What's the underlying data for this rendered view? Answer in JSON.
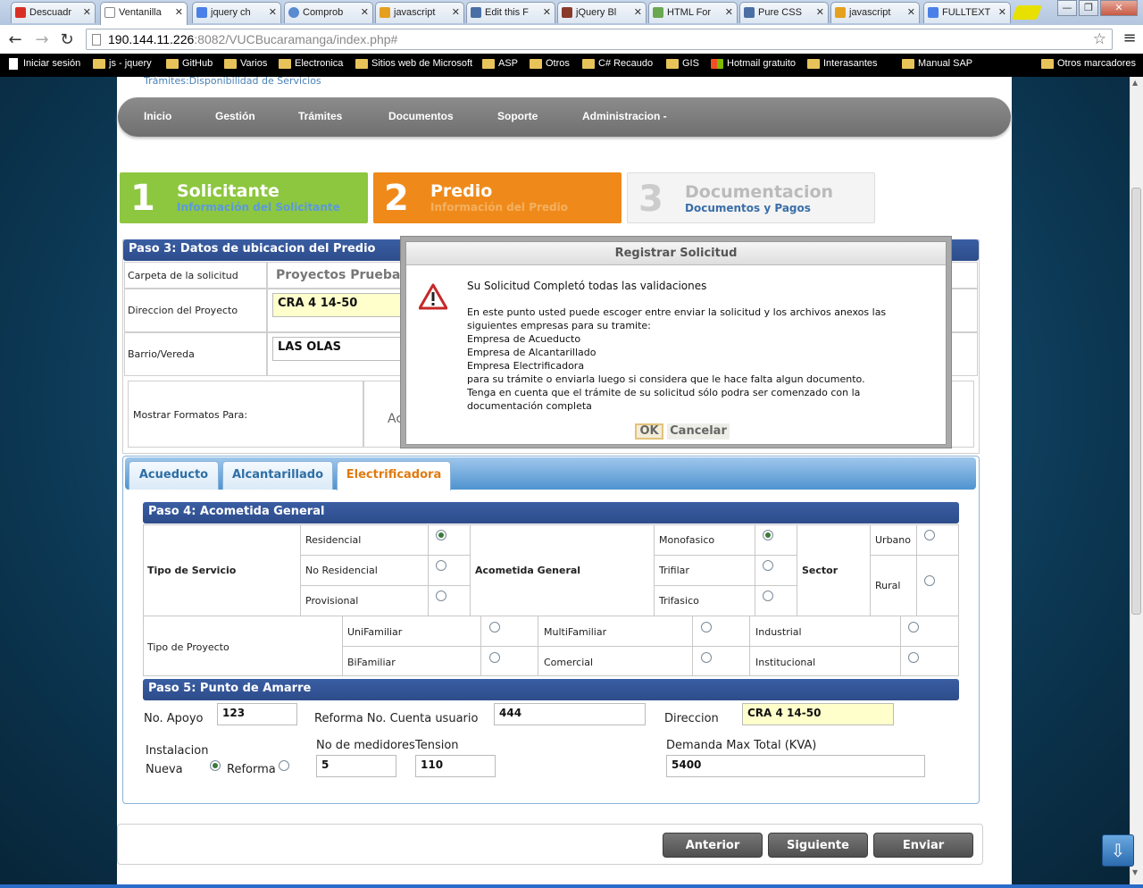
{
  "browser": {
    "tabs": [
      {
        "label": "Descuadr",
        "favicon_color": "#d93025"
      },
      {
        "label": "Ventanilla",
        "favicon_color": "#ffffff"
      },
      {
        "label": "jquery ch",
        "favicon_color": "#4a80e8"
      },
      {
        "label": "Comprob",
        "favicon_color": "#5a8ad0"
      },
      {
        "label": "javascript",
        "favicon_color": "#e5a020"
      },
      {
        "label": "Edit this F",
        "favicon_color": "#4a6fa5"
      },
      {
        "label": "jQuery Bl",
        "favicon_color": "#8a3a2a"
      },
      {
        "label": "HTML For",
        "favicon_color": "#6aa84f"
      },
      {
        "label": "Pure CSS",
        "favicon_color": "#4a6fa5"
      },
      {
        "label": "javascript",
        "favicon_color": "#e5a020"
      },
      {
        "label": "FULLTEXT",
        "favicon_color": "#4a80e8"
      }
    ],
    "url_host": "190.144.11.226",
    "url_path": ":8082/VUCBucaramanga/index.php#",
    "bookmarks": [
      "Iniciar sesión",
      "js - jquery",
      "GitHub",
      "Varios",
      "Electronica",
      "Sitios web de Microsoft",
      "ASP",
      "Otros",
      "C# Recaudo",
      "GIS",
      "Hotmail gratuito",
      "Interasantes",
      "Manual SAP"
    ],
    "other_bookmarks": "Otros marcadores"
  },
  "breadcrumb": "Trámites:Disponibilidad de Servicios",
  "menu": [
    "Inicio",
    "Gestión",
    "Trámites",
    "Documentos",
    "Soporte",
    "Administracion -"
  ],
  "steps": [
    {
      "num": "1",
      "title": "Solicitante",
      "sub": "Información del Solicitante",
      "color": "#8dc63f"
    },
    {
      "num": "2",
      "title": "Predio",
      "sub": "Información del Predio",
      "color": "#ef8a1a"
    },
    {
      "num": "3",
      "title": "Documentacion",
      "sub": "Documentos y Pagos",
      "color": "#f4f4f4"
    }
  ],
  "paso3": {
    "title": "Paso 3: Datos de ubicacion del Predio",
    "carpeta_label": "Carpeta de la solicitud",
    "carpeta_value": "Proyectos Prueba V",
    "direccion_label": "Direccion del Proyecto",
    "direccion_value": "CRA 4 14-50",
    "barrio_label": "Barrio/Vereda",
    "barrio_value": "LAS OLAS",
    "formatos_label": "Mostrar Formatos Para:",
    "formatos_partial": "Ac"
  },
  "service_tabs": [
    "Acueducto",
    "Alcantarillado",
    "Electrificadora"
  ],
  "paso4": {
    "title": "Paso 4: Acometida General",
    "tipo_servicio": "Tipo de Servicio",
    "servicio_options": [
      "Residencial",
      "No Residencial",
      "Provisional"
    ],
    "acometida": "Acometida General",
    "acometida_options": [
      "Monofasico",
      "Trifilar",
      "Trifasico"
    ],
    "sector": "Sector",
    "sector_options": [
      "Urbano",
      "Rural"
    ],
    "tipo_proyecto": "Tipo de Proyecto",
    "proyecto_options": [
      "UniFamiliar",
      "MultiFamiliar",
      "Industrial",
      "BiFamiliar",
      "Comercial",
      "Institucional"
    ]
  },
  "paso5": {
    "title": "Paso 5: Punto de Amarre",
    "apoyo_label": "No. Apoyo",
    "apoyo_value": "123",
    "reforma_label": "Reforma No. Cuenta usuario",
    "reforma_value": "444",
    "direccion_label": "Direccion",
    "direccion_value": "CRA 4 14-50",
    "instalacion_label": "Instalacion",
    "nueva_label": "Nueva",
    "reforma_radio_label": "Reforma",
    "medidores_label": "No de medidores",
    "medidores_value": "5",
    "tension_label": "Tension",
    "tension_value": "110",
    "demanda_label": "Demanda Max Total (KVA)",
    "demanda_value": "5400"
  },
  "buttons": {
    "anterior": "Anterior",
    "siguiente": "Siguiente",
    "enviar": "Enviar"
  },
  "dialog": {
    "title": "Registrar Solicitud",
    "heading": "Su Solicitud Completó todas las validaciones",
    "lines": [
      "En este punto usted puede escoger entre enviar la solicitud y los archivos anexos las",
      "siguientes empresas para su tramite:",
      "Empresa de Acueducto",
      "Empresa de Alcantarillado",
      "Empresa Electrificadora",
      "para su trámite o enviarla luego si considera que le hace falta algun documento.",
      "Tenga en cuenta que el trámite de su solicitud sólo podra ser comenzado con la",
      "documentación completa"
    ],
    "ok": "OK",
    "cancel": "Cancelar"
  }
}
